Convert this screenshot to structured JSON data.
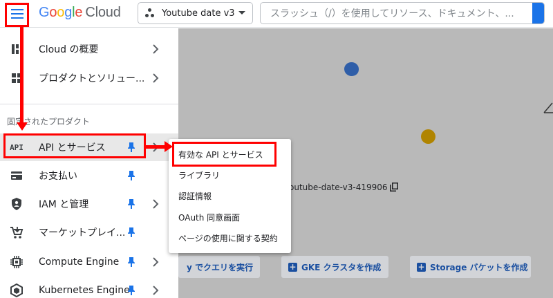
{
  "header": {
    "logo_google": "Google",
    "logo_cloud": "Cloud",
    "project_name": "Youtube date v3",
    "search_placeholder": "スラッシュ（/）を使用してリソース、ドキュメント、..."
  },
  "sidebar": {
    "items_top": [
      {
        "label": "Cloud の概要",
        "icon": "dashboard-icon"
      },
      {
        "label": "プロダクトとソリュー...",
        "icon": "grid-icon"
      }
    ],
    "section_label": "固定されたプロダクト",
    "items_pinned": [
      {
        "label": "API とサービス",
        "icon": "api-icon",
        "has_chevron": true
      },
      {
        "label": "お支払い",
        "icon": "billing-icon",
        "has_chevron": false
      },
      {
        "label": "IAM と管理",
        "icon": "shield-icon",
        "has_chevron": true
      },
      {
        "label": "マーケットプレイ...",
        "icon": "cart-icon",
        "has_chevron": false
      },
      {
        "label": "Compute Engine",
        "icon": "chip-icon",
        "has_chevron": true
      },
      {
        "label": "Kubernetes Engine",
        "icon": "hexagon-icon",
        "has_chevron": true
      }
    ],
    "api_icon_text": "API"
  },
  "submenu": {
    "items": [
      "有効な API とサービス",
      "ライブラリ",
      "認証情報",
      "OAuth 同意画面",
      "ページの使用に関する契約"
    ]
  },
  "main": {
    "project_id": "outube-date-v3-419906",
    "buttons": [
      {
        "label": "y でクエリを実行",
        "has_plus": false
      },
      {
        "label": "GKE クラスタを作成",
        "has_plus": true
      },
      {
        "label": "Storage バケットを作成",
        "has_plus": true
      }
    ]
  },
  "colors": {
    "accent": "#1a73e8",
    "annotation": "#ff0000",
    "pin": "#1a73e8"
  }
}
